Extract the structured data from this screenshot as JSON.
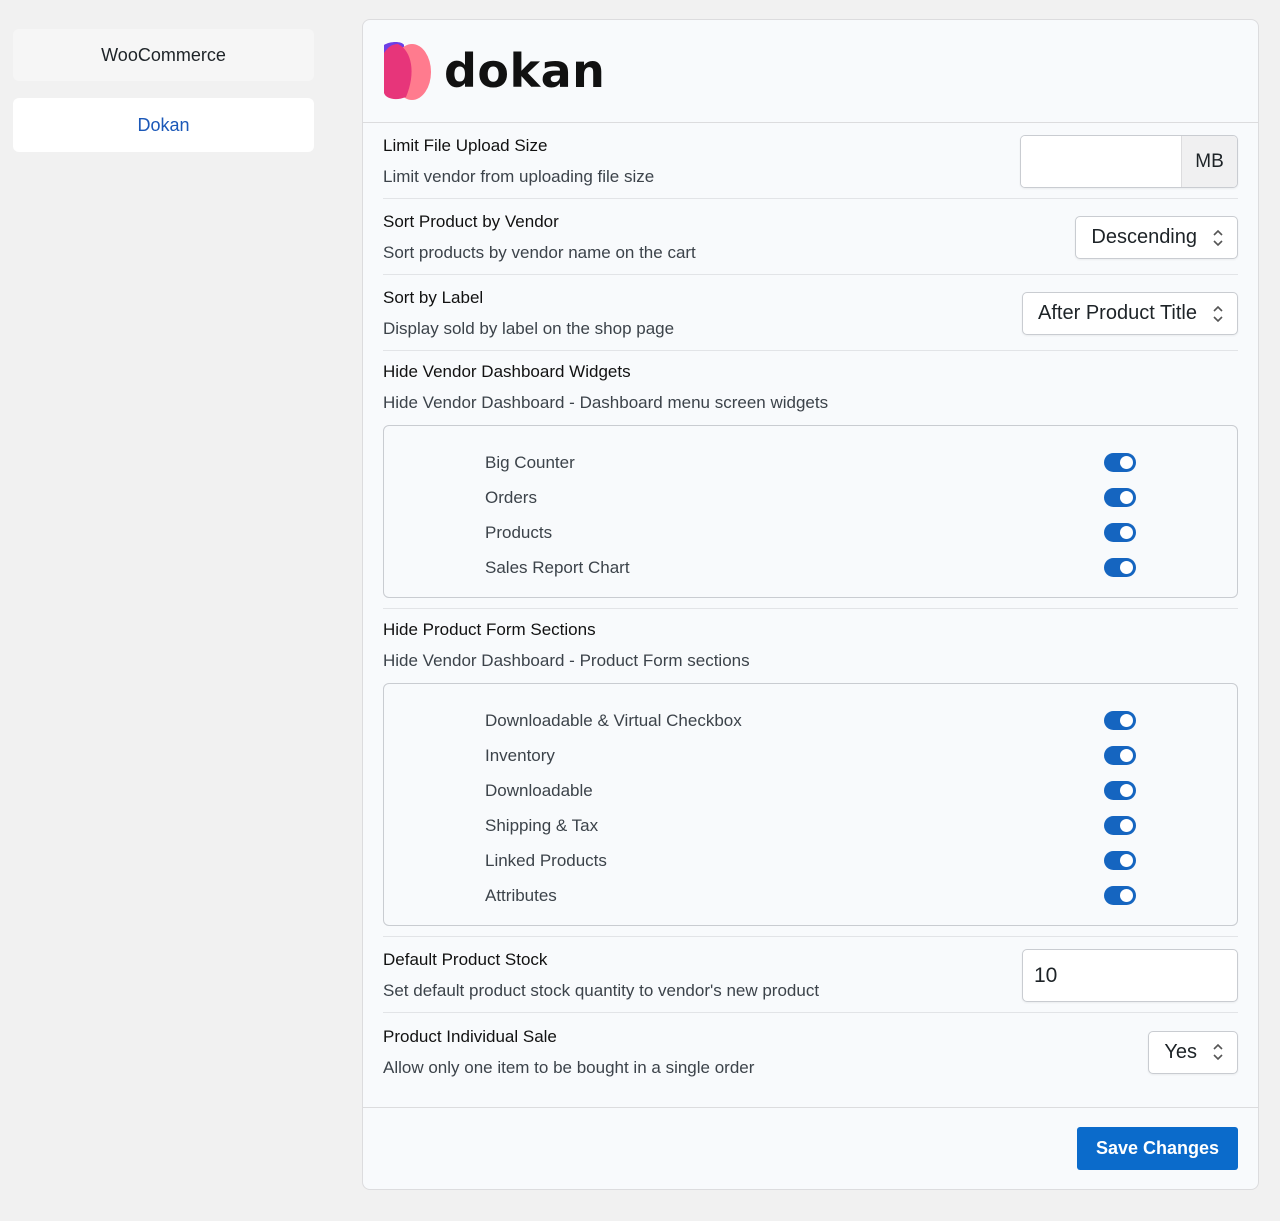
{
  "sidebar": {
    "items": [
      {
        "label": "WooCommerce",
        "active": false
      },
      {
        "label": "Dokan",
        "active": true
      }
    ]
  },
  "header": {
    "logo_text": "dokan"
  },
  "settings": {
    "upload_size": {
      "title": "Limit File Upload Size",
      "desc": "Limit vendor from uploading file size",
      "value": "",
      "unit": "MB"
    },
    "sort_vendor": {
      "title": "Sort Product by Vendor",
      "desc": "Sort products by vendor name on the cart",
      "selected": "Descending"
    },
    "sort_label": {
      "title": "Sort by Label",
      "desc": "Display sold by label on the shop page",
      "selected": "After Product Title"
    },
    "dashboard_widgets": {
      "title": "Hide Vendor Dashboard Widgets",
      "desc": "Hide Vendor Dashboard - Dashboard menu screen widgets",
      "items": [
        {
          "label": "Big Counter",
          "on": true
        },
        {
          "label": "Orders",
          "on": true
        },
        {
          "label": "Products",
          "on": true
        },
        {
          "label": "Sales Report Chart",
          "on": true
        }
      ]
    },
    "product_form": {
      "title": "Hide Product Form Sections",
      "desc": "Hide Vendor Dashboard - Product Form sections",
      "items": [
        {
          "label": "Downloadable & Virtual Checkbox",
          "on": true
        },
        {
          "label": "Inventory",
          "on": true
        },
        {
          "label": "Downloadable",
          "on": true
        },
        {
          "label": "Shipping & Tax",
          "on": true
        },
        {
          "label": "Linked Products",
          "on": true
        },
        {
          "label": "Attributes",
          "on": true
        }
      ]
    },
    "default_stock": {
      "title": "Default Product Stock",
      "desc": "Set default product stock quantity to vendor's new product",
      "value": "10"
    },
    "individual_sale": {
      "title": "Product Individual Sale",
      "desc": "Allow only one item to be bought in a single order",
      "selected": "Yes"
    }
  },
  "footer": {
    "save_label": "Save Changes"
  },
  "colors": {
    "accent": "#0b6bcb",
    "toggle_on": "#1565c0",
    "active_nav": "#1b58b8"
  }
}
